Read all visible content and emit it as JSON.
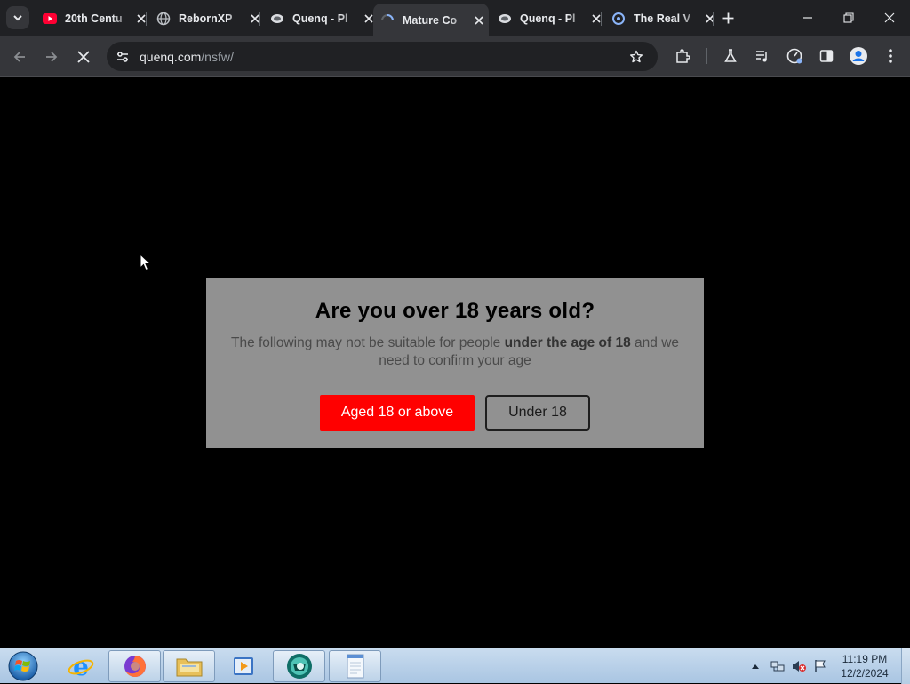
{
  "browser": {
    "tabs": [
      {
        "title": "20th Centu",
        "icon": "youtube-icon",
        "active": false
      },
      {
        "title": "RebornXP",
        "icon": "globe-icon",
        "active": false
      },
      {
        "title": "Quenq - Pl",
        "icon": "quenq-icon",
        "active": false
      },
      {
        "title": "Mature Co",
        "icon": "loading-icon",
        "active": true
      },
      {
        "title": "Quenq - Pl",
        "icon": "quenq-icon",
        "active": false
      },
      {
        "title": "The Real V",
        "icon": "site-icon",
        "active": false
      }
    ],
    "url_host": "quenq.com",
    "url_path": "/nsfw/"
  },
  "dialog": {
    "title": "Are you over 18 years old?",
    "text_before": "The following may not be suitable for people ",
    "text_bold": "under the age of 18",
    "text_after": " and we need to confirm your age",
    "confirm_label": "Aged 18 or above",
    "decline_label": "Under 18"
  },
  "taskbar": {
    "time": "11:19 PM",
    "date": "12/2/2024",
    "apps": [
      "internet-explorer-icon",
      "firefox-icon",
      "file-explorer-icon",
      "media-player-icon",
      "chrome-icon",
      "notepad-icon"
    ]
  },
  "colors": {
    "accent_button": "#ff0000",
    "dialog_bg": "#919191"
  }
}
